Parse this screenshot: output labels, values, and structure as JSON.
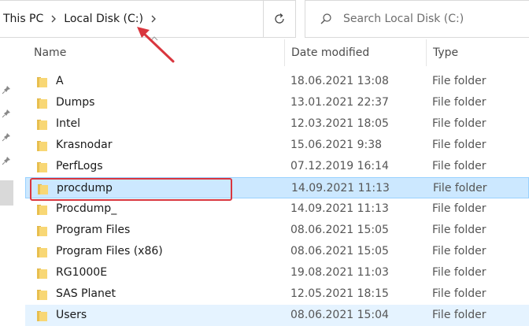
{
  "address_bar": {
    "crumbs": [
      "This PC",
      "Local Disk (C:)"
    ]
  },
  "search": {
    "placeholder": "Search Local Disk (C:)"
  },
  "columns": {
    "name": "Name",
    "date": "Date modified",
    "type": "Type"
  },
  "rows": [
    {
      "name": "A",
      "date": "18.06.2021 13:08",
      "type": "File folder"
    },
    {
      "name": "Dumps",
      "date": "13.01.2021 22:37",
      "type": "File folder"
    },
    {
      "name": "Intel",
      "date": "12.03.2021 18:05",
      "type": "File folder"
    },
    {
      "name": "Krasnodar",
      "date": "15.06.2021 9:38",
      "type": "File folder"
    },
    {
      "name": "PerfLogs",
      "date": "07.12.2019 16:14",
      "type": "File folder"
    },
    {
      "name": "procdump",
      "date": "14.09.2021 11:13",
      "type": "File folder"
    },
    {
      "name": "Procdump_",
      "date": "14.09.2021 11:13",
      "type": "File folder"
    },
    {
      "name": "Program Files",
      "date": "08.06.2021 15:05",
      "type": "File folder"
    },
    {
      "name": "Program Files (x86)",
      "date": "08.06.2021 15:05",
      "type": "File folder"
    },
    {
      "name": "RG1000E",
      "date": "19.08.2021 11:03",
      "type": "File folder"
    },
    {
      "name": "SAS Planet",
      "date": "12.05.2021 18:15",
      "type": "File folder"
    },
    {
      "name": "Users",
      "date": "08.06.2021 15:04",
      "type": "File folder"
    }
  ],
  "selected_row": "procdump",
  "hovered_row": "Users",
  "icons": {
    "folder": "folder-icon",
    "pin": "pin-icon",
    "chevron": "chevron-right-icon",
    "refresh": "refresh-icon",
    "search": "search-icon",
    "annotation": "red-arrow-annotation"
  },
  "colors": {
    "selected_bg": "#cce8ff",
    "hover_bg": "#e5f3ff",
    "annotation_red": "#d9363e",
    "folder_yellow": "#f8d775"
  }
}
